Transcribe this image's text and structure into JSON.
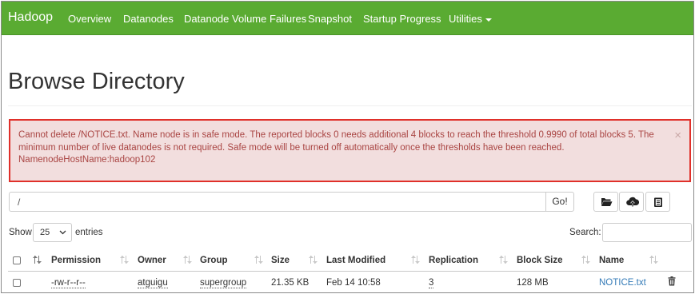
{
  "navbar": {
    "brand": "Hadoop",
    "links": [
      "Overview",
      "Datanodes",
      "Datanode Volume Failures",
      "Snapshot",
      "Startup Progress"
    ],
    "utilities": "Utilities",
    "bg_color": "#5aab32"
  },
  "page": {
    "title": "Browse Directory"
  },
  "alert": {
    "line1": "Cannot delete /NOTICE.txt. Name node is in safe mode. The reported blocks 0 needs additional 4 blocks to reach the threshold 0.9990 of total blocks 5. The",
    "line2": "minimum number of live datanodes is not required. Safe mode will be turned off automatically once the thresholds have been reached.",
    "line3": "NamenodeHostName:hadoop102",
    "close": "×",
    "bg_color": "#f2dede",
    "border_color": "#e0302a",
    "text_color": "#a94442"
  },
  "pathbar": {
    "path_value": "/",
    "go_label": "Go!",
    "icons": [
      "folder-open-icon",
      "cloud-upload-icon",
      "clipboard-icon"
    ]
  },
  "table_controls": {
    "show_label": "Show",
    "entries_value": "25",
    "entries_label": "entries",
    "search_label": "Search:",
    "search_value": ""
  },
  "table": {
    "columns": [
      "Permission",
      "Owner",
      "Group",
      "Size",
      "Last Modified",
      "Replication",
      "Block Size",
      "Name"
    ],
    "rows": [
      {
        "permission": "-rw-r--r--",
        "owner": "atguigu",
        "group": "supergroup",
        "size": "21.35 KB",
        "last_modified": "Feb 14 10:58",
        "replication": "3",
        "block_size": "128 MB",
        "name": "NOTICE.txt"
      }
    ],
    "link_color": "#337ab7"
  }
}
